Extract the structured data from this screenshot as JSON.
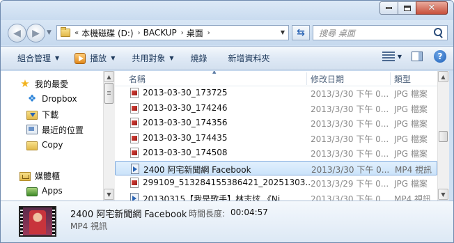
{
  "window": {
    "controls": {
      "minimize": "minimize",
      "maximize": "maximize",
      "close": "✕"
    }
  },
  "address_bar": {
    "overflow": "«",
    "crumbs": [
      "本機磁碟 (D:)",
      "BACKUP",
      "桌面"
    ],
    "separator": "›"
  },
  "search": {
    "placeholder": "搜尋 桌面"
  },
  "toolbar": {
    "organize": "組合管理",
    "play": "播放",
    "share": "共用對象",
    "burn": "燒錄",
    "new_folder": "新增資料夾",
    "help": "?"
  },
  "sidebar": {
    "favorites": "我的最愛",
    "items": [
      "Dropbox",
      "下載",
      "最近的位置",
      "Copy"
    ],
    "libraries": "媒體櫃",
    "library_items": [
      "Apps"
    ]
  },
  "columns": {
    "name": "名稱",
    "date": "修改日期",
    "type": "類型"
  },
  "files": [
    {
      "name": "2013-03-30_173725",
      "date": "2013/3/30 下午 0...",
      "type": "JPG 檔案",
      "icon": "jpg"
    },
    {
      "name": "2013-03-30_174246",
      "date": "2013/3/30 下午 0...",
      "type": "JPG 檔案",
      "icon": "jpg"
    },
    {
      "name": "2013-03-30_174356",
      "date": "2013/3/30 下午 0...",
      "type": "JPG 檔案",
      "icon": "jpg"
    },
    {
      "name": "2013-03-30_174435",
      "date": "2013/3/30 下午 0...",
      "type": "JPG 檔案",
      "icon": "jpg"
    },
    {
      "name": "2013-03-30_174508",
      "date": "2013/3/30 下午 0...",
      "type": "JPG 檔案",
      "icon": "jpg"
    },
    {
      "name": "2400 阿宅新聞網   Facebook",
      "date": "2013/3/30 下午 0...",
      "type": "MP4 視訊",
      "icon": "mp4",
      "selected": true
    },
    {
      "name": "299109_513284155386421_20251303...",
      "date": "2013/3/29 下午 0...",
      "type": "JPG 檔案",
      "icon": "jpg"
    },
    {
      "name": "20130315【我是歌手】林志炫 《Ni...",
      "date": "2013/3/30 下午 0...",
      "type": "MP4 視訊",
      "icon": "mp4"
    }
  ],
  "details": {
    "name": "2400 阿宅新聞網   Facebook",
    "duration_label": "時間長度:",
    "duration": "00:04:57",
    "type": "MP4 視訊"
  }
}
